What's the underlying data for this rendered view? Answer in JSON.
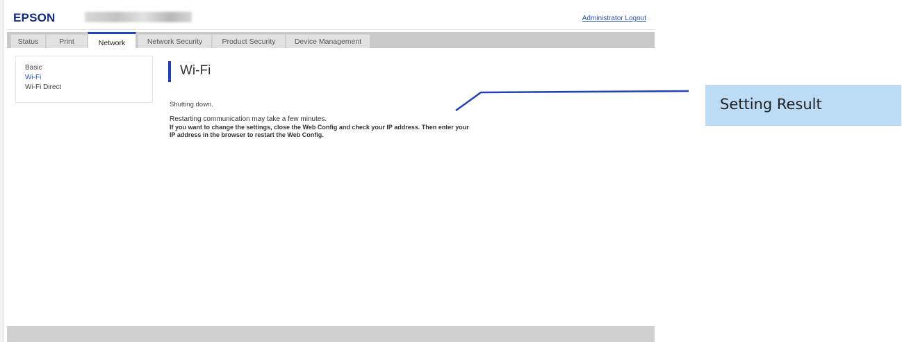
{
  "header": {
    "logo": "EPSON",
    "logout_label": "Administrator Logout"
  },
  "tabs": [
    {
      "label": "Status",
      "active": false
    },
    {
      "label": "Print",
      "active": false
    },
    {
      "label": "Network",
      "active": true
    },
    {
      "label": "Network Security",
      "active": false
    },
    {
      "label": "Product Security",
      "active": false
    },
    {
      "label": "Device Management",
      "active": false
    }
  ],
  "sidebar": {
    "items": [
      {
        "label": "Basic",
        "current": false
      },
      {
        "label": "Wi-Fi",
        "current": true
      },
      {
        "label": "Wi-Fi Direct",
        "current": false
      }
    ]
  },
  "main": {
    "title": "Wi-Fi",
    "status_text": "Shutting down.",
    "message_1": "Restarting communication may take a few minutes.",
    "message_2": "If you want to change the settings, close the Web Config and check your IP address. Then enter your IP address in the browser to restart the Web Config."
  },
  "annotation": {
    "label": "Setting Result"
  },
  "colors": {
    "brand": "#102a86",
    "accent": "#1f3fc0",
    "link": "#2a50b8",
    "callout_bg": "#bcdcf5"
  }
}
